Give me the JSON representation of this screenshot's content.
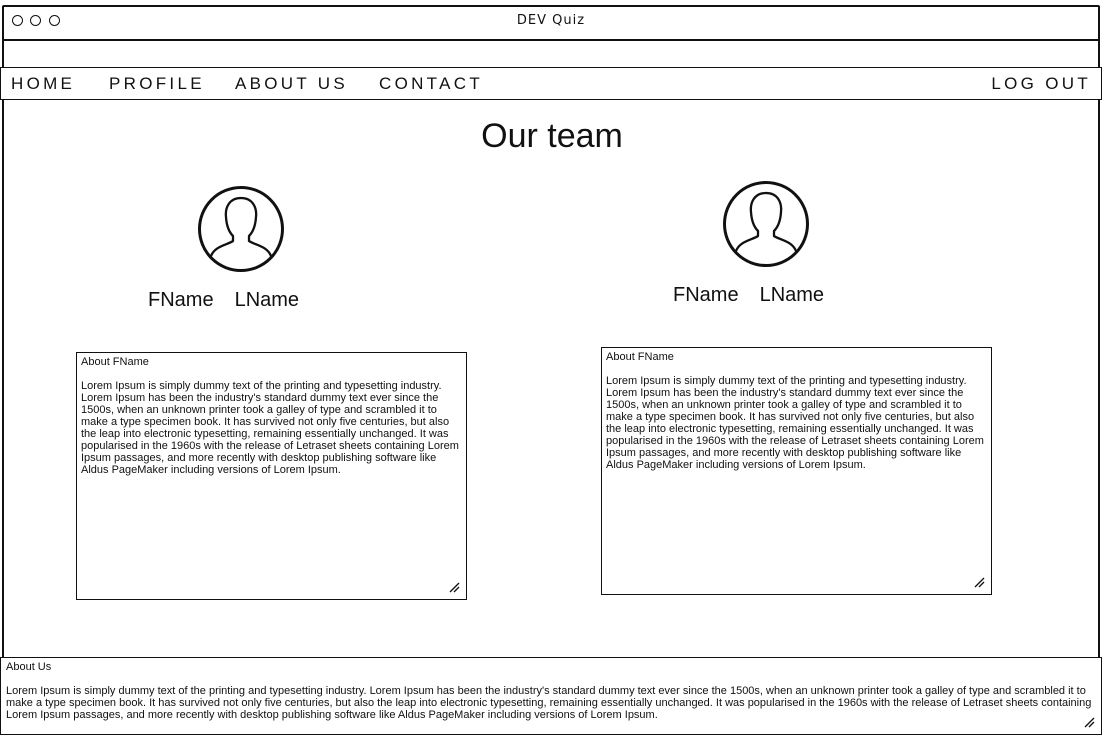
{
  "window": {
    "title": "DEV Quiz"
  },
  "nav": {
    "items": [
      "HOME",
      "PROFILE",
      "ABOUT US",
      "CONTACT"
    ],
    "logout": "LOG OUT"
  },
  "page": {
    "title": "Our team"
  },
  "team": [
    {
      "first_name": "FName",
      "last_name": "LName",
      "about_title": "About FName",
      "about_text": "Lorem Ipsum is simply dummy text of the printing and typesetting industry. Lorem Ipsum has been the industry's standard dummy text ever since the 1500s, when an unknown printer took a galley of type and scrambled it to make a type specimen book. It has survived not only five centuries, but also the leap into electronic typesetting, remaining essentially unchanged. It was popularised in the 1960s with the release of Letraset sheets containing Lorem Ipsum passages, and more recently with desktop publishing software like Aldus PageMaker including versions of Lorem Ipsum."
    },
    {
      "first_name": "FName",
      "last_name": "LName",
      "about_title": "About FName",
      "about_text": "Lorem Ipsum is simply dummy text of the printing and typesetting industry. Lorem Ipsum has been the industry's standard dummy text ever since the 1500s, when an unknown printer took a galley of type and scrambled it to make a type specimen book. It has survived not only five centuries, but also the leap into electronic typesetting, remaining essentially unchanged. It was popularised in the 1960s with the release of Letraset sheets containing Lorem Ipsum passages, and more recently with desktop publishing software like Aldus PageMaker including versions of Lorem Ipsum."
    }
  ],
  "footer": {
    "title": "About Us",
    "text": "Lorem Ipsum is simply dummy text of the printing and typesetting industry. Lorem Ipsum has been the industry's standard dummy text ever since the 1500s, when an unknown printer took a galley of type and scrambled it to make a type specimen book. It has survived not only five centuries, but also the leap into electronic typesetting, remaining essentially unchanged. It was popularised in the 1960s with the release of Letraset sheets containing Lorem Ipsum passages, and more recently with desktop publishing software like Aldus PageMaker including versions of Lorem Ipsum."
  },
  "icons": {
    "window_controls": [
      "window-control-icon",
      "window-control-icon",
      "window-control-icon"
    ],
    "avatar": "user-avatar-icon",
    "resize": "resize-handle-icon"
  }
}
